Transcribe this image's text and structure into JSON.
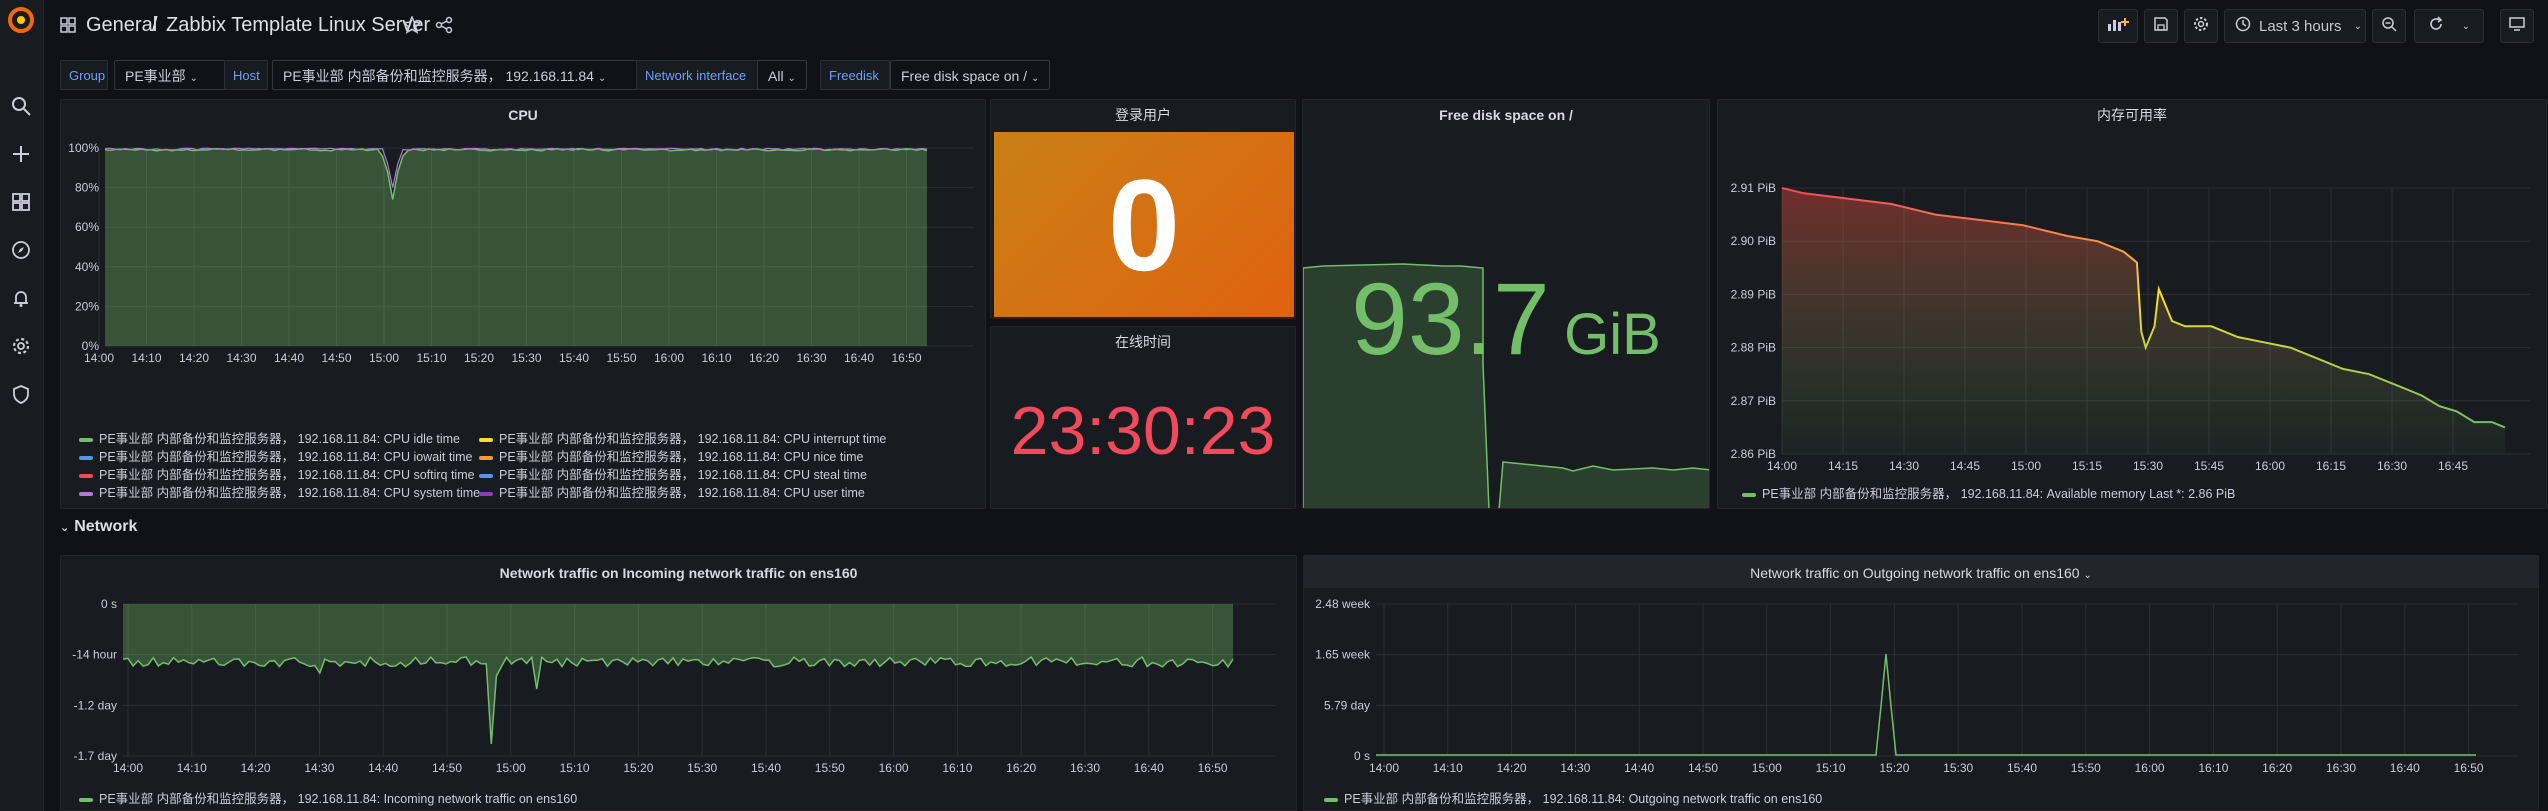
{
  "breadcrumb": {
    "folder": "General",
    "dashboard": "Zabbix Template Linux Server"
  },
  "timepicker": {
    "label": "Last 3 hours"
  },
  "icons": {
    "app": "grafana-logo",
    "nav": [
      "search-icon",
      "plus-icon",
      "dashboards-icon",
      "explore-icon",
      "alerting-icon",
      "settings-icon",
      "shield-icon"
    ]
  },
  "variables": [
    {
      "label": "Group",
      "value": "PE事业部"
    },
    {
      "label": "Host",
      "value": "PE事业部 内部备份和监控服务器， 192.168.11.84"
    },
    {
      "label": "Network interface",
      "value": "All"
    },
    {
      "label": "Freedisk",
      "value": "Free disk space on /"
    }
  ],
  "panels": {
    "cpu": {
      "title": "CPU",
      "yticks": [
        "100%",
        "80%",
        "60%",
        "40%",
        "20%",
        "0%"
      ],
      "xticks": [
        "14:00",
        "14:10",
        "14:20",
        "14:30",
        "14:40",
        "14:50",
        "15:00",
        "15:10",
        "15:20",
        "15:30",
        "15:40",
        "15:50",
        "16:00",
        "16:10",
        "16:20",
        "16:30",
        "16:40",
        "16:50"
      ],
      "legend": [
        {
          "label": "PE事业部 内部备份和监控服务器， 192.168.11.84: CPU idle time",
          "color": "#73bf69"
        },
        {
          "label": "PE事业部 内部备份和监控服务器， 192.168.11.84: CPU interrupt time",
          "color": "#fade2a"
        },
        {
          "label": "PE事业部 内部备份和监控服务器， 192.168.11.84: CPU iowait time",
          "color": "#5794f2"
        },
        {
          "label": "PE事业部 内部备份和监控服务器， 192.168.11.84: CPU nice time",
          "color": "#ff9830"
        },
        {
          "label": "PE事业部 内部备份和监控服务器， 192.168.11.84: CPU softirq time",
          "color": "#f2495c"
        },
        {
          "label": "PE事业部 内部备份和监控服务器， 192.168.11.84: CPU steal time",
          "color": "#5794f2"
        },
        {
          "label": "PE事业部 内部备份和监控服务器， 192.168.11.84: CPU system time",
          "color": "#b877d9"
        },
        {
          "label": "PE事业部 内部备份和监控服务器， 192.168.11.84: CPU user time",
          "color": "#8f3bb8"
        }
      ]
    },
    "login": {
      "title": "登录用户",
      "value": "0"
    },
    "uptime": {
      "title": "在线时间",
      "value": "23:30:23"
    },
    "disk": {
      "title": "Free disk space on /",
      "value": "93.7",
      "unit": "GiB"
    },
    "memory": {
      "title": "内存可用率",
      "yticks": [
        "2.91 PiB",
        "2.90 PiB",
        "2.89 PiB",
        "2.88 PiB",
        "2.87 PiB",
        "2.86 PiB"
      ],
      "xticks": [
        "14:00",
        "14:15",
        "14:30",
        "14:45",
        "15:00",
        "15:15",
        "15:30",
        "15:45",
        "16:00",
        "16:15",
        "16:30",
        "16:45"
      ],
      "legend": "PE事业部 内部备份和监控服务器， 192.168.11.84: Available memory  Last *: 2.86 PiB"
    },
    "row": {
      "title": "Network"
    },
    "netin": {
      "title": "Network traffic on Incoming network traffic on ens160",
      "yticks": [
        "0 s",
        "-14 hour",
        "-1.2 day",
        "-1.7 day"
      ],
      "xticks": [
        "14:00",
        "14:10",
        "14:20",
        "14:30",
        "14:40",
        "14:50",
        "15:00",
        "15:10",
        "15:20",
        "15:30",
        "15:40",
        "15:50",
        "16:00",
        "16:10",
        "16:20",
        "16:30",
        "16:40",
        "16:50"
      ],
      "legend": "PE事业部 内部备份和监控服务器， 192.168.11.84: Incoming network traffic on ens160"
    },
    "netout": {
      "title": "Network traffic on Outgoing network traffic on ens160",
      "yticks": [
        "2.48 week",
        "1.65 week",
        "5.79 day",
        "0 s"
      ],
      "xticks": [
        "14:00",
        "14:10",
        "14:20",
        "14:30",
        "14:40",
        "14:50",
        "15:00",
        "15:10",
        "15:20",
        "15:30",
        "15:40",
        "15:50",
        "16:00",
        "16:10",
        "16:20",
        "16:30",
        "16:40",
        "16:50"
      ],
      "legend": "PE事业部 内部备份和监控服务器， 192.168.11.84: Outgoing network traffic on ens160"
    }
  }
}
